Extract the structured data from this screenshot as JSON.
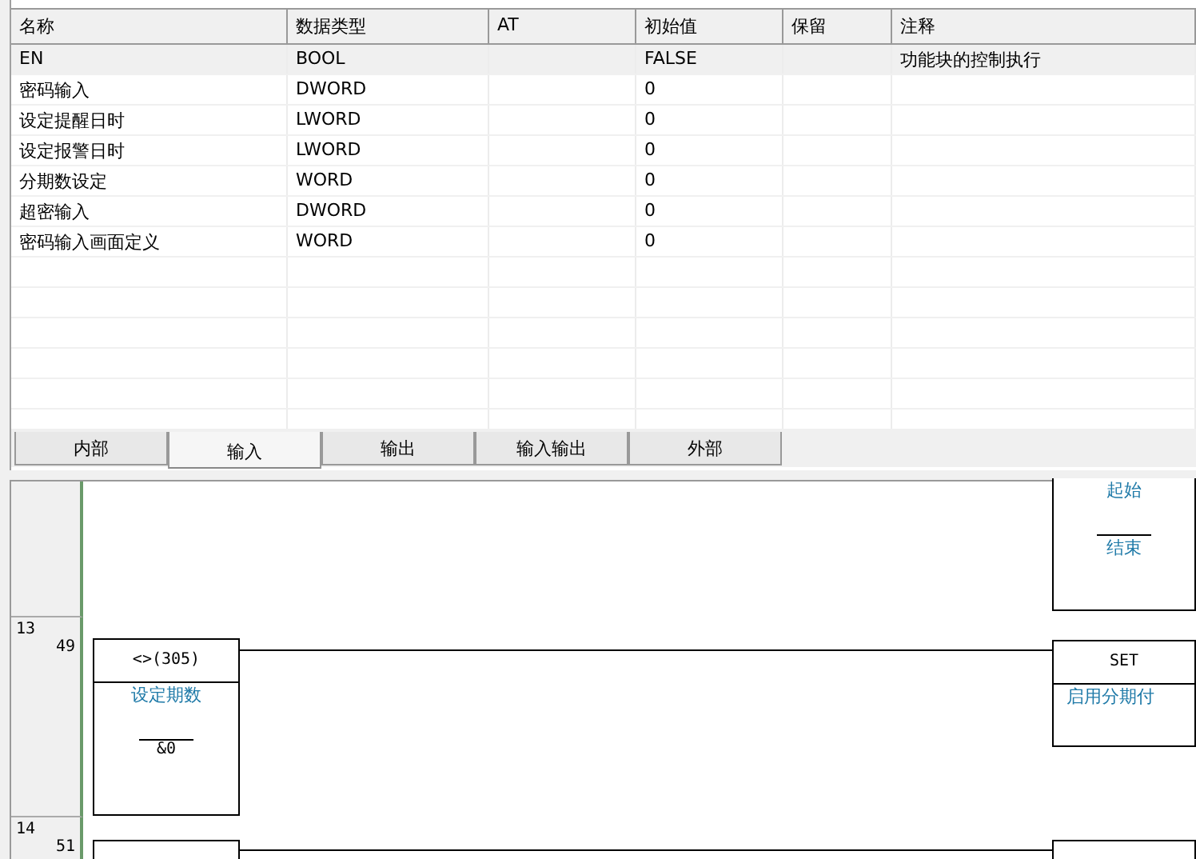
{
  "table": {
    "columns": [
      "名称",
      "数据类型",
      "AT",
      "初始值",
      "保留",
      "注释"
    ],
    "rows": [
      {
        "cells": [
          "EN",
          "BOOL",
          "",
          "FALSE",
          "",
          "功能块的控制执行"
        ],
        "selected": true
      },
      {
        "cells": [
          "密码输入",
          "DWORD",
          "",
          "0",
          "",
          ""
        ],
        "selected": false
      },
      {
        "cells": [
          "设定提醒日时",
          "LWORD",
          "",
          "0",
          "",
          ""
        ],
        "selected": false
      },
      {
        "cells": [
          "设定报警日时",
          "LWORD",
          "",
          "0",
          "",
          ""
        ],
        "selected": false
      },
      {
        "cells": [
          "分期数设定",
          "WORD",
          "",
          "0",
          "",
          ""
        ],
        "selected": false
      },
      {
        "cells": [
          "超密输入",
          "DWORD",
          "",
          "0",
          "",
          ""
        ],
        "selected": false
      },
      {
        "cells": [
          "密码输入画面定义",
          "WORD",
          "",
          "0",
          "",
          ""
        ],
        "selected": false
      }
    ]
  },
  "tabs": [
    {
      "label": "内部",
      "selected": false
    },
    {
      "label": "输入",
      "selected": true
    },
    {
      "label": "输出",
      "selected": false
    },
    {
      "label": "输入输出",
      "selected": false
    },
    {
      "label": "外部",
      "selected": false
    }
  ],
  "ladder": {
    "rungs": [
      {
        "right_block": {
          "kind": "range",
          "top": "起始",
          "bottom": "结束"
        }
      },
      {
        "rung": "13",
        "step": "49",
        "left_block": {
          "kind": "instruction",
          "title": "<>(305)",
          "operand": "设定期数",
          "value": "&0"
        },
        "right_block": {
          "kind": "instruction",
          "title": "SET",
          "operand": "启用分期付"
        }
      },
      {
        "rung": "14",
        "step": "51",
        "left_block": {
          "kind": "cut"
        },
        "right_block": {
          "kind": "cut"
        }
      }
    ]
  }
}
